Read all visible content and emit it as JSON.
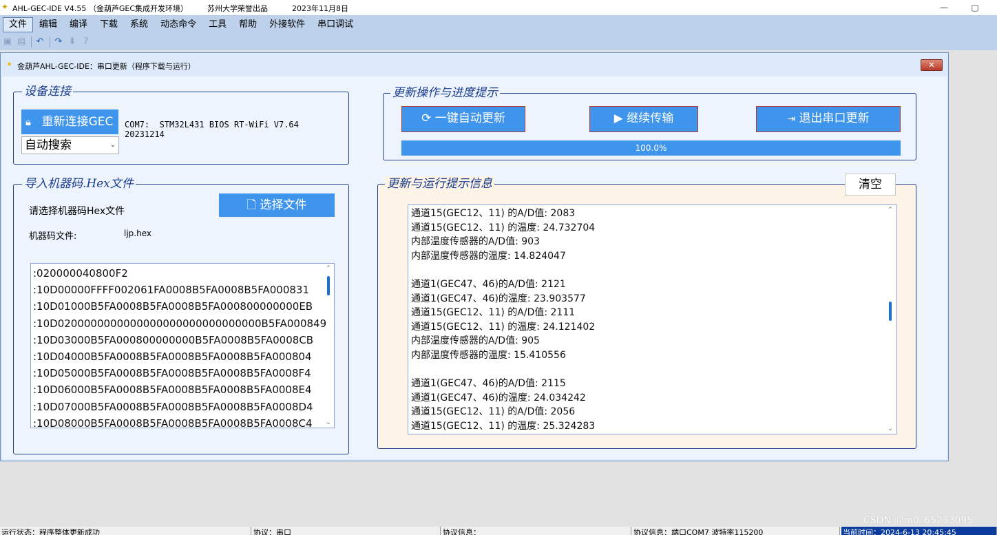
{
  "window": {
    "title": "AHL-GEC-IDE V4.55 （金葫芦GEC集成开发环境）        苏州大学荣誉出品          2023年11月8日",
    "minimize_glyph": "—",
    "restore_glyph": "▢"
  },
  "menu": {
    "items": [
      "文件",
      "编辑",
      "编译",
      "下载",
      "系统",
      "动态命令",
      "工具",
      "帮助",
      "外接软件",
      "串口调试"
    ]
  },
  "toolbar": {
    "icons": [
      "save-icon",
      "save-all-icon",
      "undo-icon",
      "redo-icon",
      "download-icon",
      "help-icon"
    ]
  },
  "dialog": {
    "title": "金葫芦AHL-GEC-IDE：串口更新（程序下载与运行）",
    "close_glyph": "✕"
  },
  "device": {
    "legend": "设备连接",
    "reconnect_label": "重新连接GEC",
    "info_line1": "COM7:  STM32L431 BIOS RT-WiFi V7.64",
    "info_line2": "20231214",
    "search_mode": "自动搜索"
  },
  "hex_import": {
    "legend": "导入机器码.Hex文件",
    "prompt": "请选择机器码Hex文件",
    "select_label": "选择文件",
    "file_label": "机器码文件:",
    "file_name": "ljp.hex",
    "lines": [
      ":020000040800F2",
      ":10D00000FFFF002061FA0008B5FA0008B5FA000831",
      ":10D01000B5FA0008B5FA0008B5FA000800000000EB",
      ":10D0200000000000000000000000000000B5FA000849",
      ":10D03000B5FA000800000000B5FA0008B5FA0008CB",
      ":10D04000B5FA0008B5FA0008B5FA0008B5FA000804",
      ":10D05000B5FA0008B5FA0008B5FA0008B5FA0008F4",
      ":10D06000B5FA0008B5FA0008B5FA0008B5FA0008E4",
      ":10D07000B5FA0008B5FA0008B5FA0008B5FA0008D4",
      ":10D08000B5FA0008B5FA0008B5FA0008B5FA0008C4"
    ]
  },
  "update_ops": {
    "legend": "更新操作与进度提示",
    "auto_update_label": "一键自动更新",
    "continue_label": "继续传输",
    "exit_label": "退出串口更新",
    "progress_text": "100.0%",
    "progress_value": 1.0
  },
  "run_info": {
    "legend": "更新与运行提示信息",
    "clear_label": "清空",
    "lines": [
      "通道15(GEC12、11) 的A/D值: 2083",
      "通道15(GEC12、11) 的温度: 24.732704",
      "内部温度传感器的A/D值: 903",
      "内部温度传感器的温度: 14.824047",
      "",
      "通道1(GEC47、46)的A/D值:  2121",
      "通道1(GEC47、46)的温度:  23.903577",
      "通道15(GEC12、11) 的A/D值: 2111",
      "通道15(GEC12、11) 的温度: 24.121402",
      "内部温度传感器的A/D值: 905",
      "内部温度传感器的温度: 15.410556",
      "",
      "通道1(GEC47、46)的A/D值:  2115",
      "通道1(GEC47、46)的温度:  24.034242",
      "通道15(GEC12、11) 的A/D值: 2056",
      "通道15(GEC12、11) 的温度: 25.324283"
    ]
  },
  "statusbar": {
    "run_status": "运行状态：程序整体更新成功",
    "protocol": "协议：串口",
    "protocol_info": "协议信息：",
    "protocol_detail": "协议信息：端口COM7 波特率115200",
    "time": "当前时间：2024-6-13 20:45:45"
  },
  "watermark": "CSDN @m0_65233095",
  "colors": {
    "menubar": "#bdd1ea",
    "dialog_bg": "#eef4fd",
    "accent_blue": "#3f95eb",
    "legend_text": "#1a3d8f",
    "log_panel": "#fdf3e6"
  }
}
